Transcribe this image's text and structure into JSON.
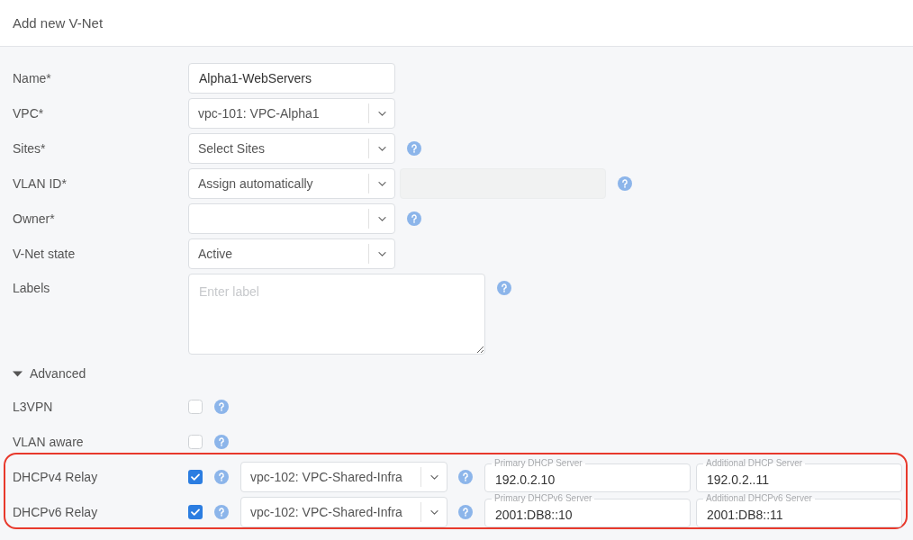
{
  "dialog": {
    "title": "Add new V-Net"
  },
  "fields": [
    {
      "kind": "text",
      "label": "Name*",
      "value": "Alpha1-WebServers",
      "help": false
    },
    {
      "kind": "select",
      "label": "VPC*",
      "value": "vpc-101: VPC-Alpha1",
      "help": false
    },
    {
      "kind": "select",
      "label": "Sites*",
      "value": "Select Sites",
      "help": true
    },
    {
      "kind": "select",
      "label": "VLAN ID*",
      "value": "Assign automatically",
      "extra_field": {
        "disabled": true
      },
      "help": true
    },
    {
      "kind": "select",
      "label": "Owner*",
      "help": true
    },
    {
      "kind": "select",
      "label": "V-Net state",
      "value": "Active",
      "help": false
    },
    {
      "kind": "textarea",
      "label": "Labels",
      "placeholder": "Enter label",
      "help": true
    }
  ],
  "advanced": {
    "label": "Advanced",
    "expanded": true,
    "options": [
      {
        "label": "L3VPN",
        "checked": false
      },
      {
        "label": "VLAN aware",
        "checked": false
      }
    ],
    "relays": {
      "highlighted": true,
      "rows": [
        {
          "label": "DHCPv4 Relay",
          "checked": true,
          "vpc": "vpc-102: VPC-Shared-Infra",
          "servers": [
            {
              "legend": "Primary DHCP Server",
              "value": "192.0.2.10"
            },
            {
              "legend": "Additional DHCP Server",
              "value": "192.0.2..11"
            }
          ]
        },
        {
          "label": "DHCPv6 Relay",
          "checked": true,
          "vpc": "vpc-102: VPC-Shared-Infra",
          "servers": [
            {
              "legend": "Primary DHCPv6 Server",
              "value": "2001:DB8::10"
            },
            {
              "legend": "Additional DHCPv6 Server",
              "value": "2001:DB8::11"
            }
          ]
        }
      ]
    }
  }
}
